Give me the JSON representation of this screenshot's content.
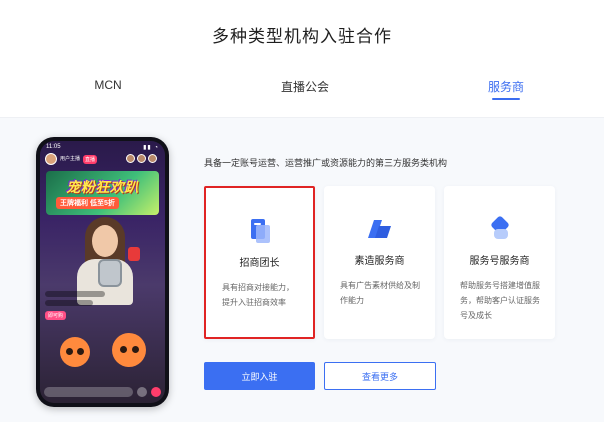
{
  "header": {
    "title": "多种类型机构入驻合作"
  },
  "tabs": [
    {
      "label": "MCN",
      "active": false
    },
    {
      "label": "直播公会",
      "active": false
    },
    {
      "label": "服务商",
      "active": true
    }
  ],
  "content": {
    "description": "具备一定账号运营、运营推广或资源能力的第三方服务类机构",
    "cards": [
      {
        "title": "招商团长",
        "desc": "具有招商对接能力，提升入驻招商效率",
        "icon": "document-square-icon",
        "selected": true
      },
      {
        "title": "素造服务商",
        "desc": "具有广告素材供给及制作能力",
        "icon": "layered-shape-icon",
        "selected": false
      },
      {
        "title": "服务号服务商",
        "desc": "帮助服务号搭建增值服务，帮助客户认证服务号及成长",
        "icon": "diamond-heart-icon",
        "selected": false
      }
    ],
    "primary_button": "立即入驻",
    "secondary_button": "查看更多"
  },
  "phone": {
    "status_time": "11:05",
    "status_icons": "▮▮ ◔",
    "host_name": "用户主播",
    "live_tag": "直播",
    "banner_title": "宠粉狂欢趴",
    "banner_sub": "王牌福利 低至5折",
    "pink_tag": "即可购",
    "accent_color": "#3b6ff2",
    "selection_color": "#e02424"
  }
}
